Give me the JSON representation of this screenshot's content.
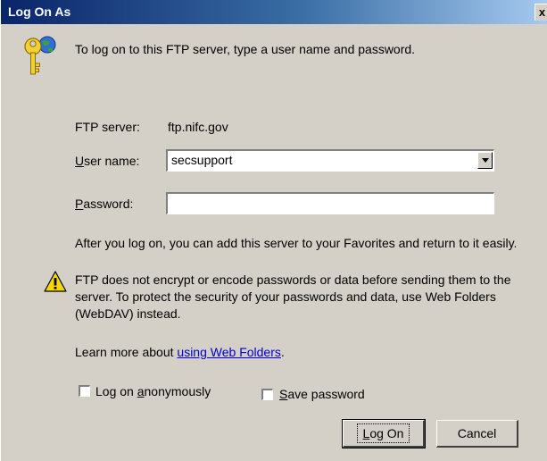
{
  "window": {
    "title": "Log On As",
    "close_glyph": "x"
  },
  "intro": {
    "icon": "key-globe-icon",
    "text": "To log on to this FTP server, type a user name and password."
  },
  "server": {
    "label": "FTP server:",
    "value": "ftp.nifc.gov"
  },
  "username": {
    "label_accel": "U",
    "label_rest": "ser name:",
    "value": "secsupport"
  },
  "password": {
    "label_accel": "P",
    "label_rest": "assword:",
    "value": ""
  },
  "favorites_note": "After you log on, you can add this server to your Favorites and return to it easily.",
  "warning": {
    "icon": "warning-icon",
    "line1": "FTP does not encrypt or encode passwords or data before sending them to the",
    "line2": "server.  To protect the security of your passwords and data, use Web Folders",
    "line3": "(WebDAV) instead."
  },
  "learn_more": {
    "prefix": "Learn more about ",
    "link": "using Web Folders",
    "suffix": "."
  },
  "options": {
    "anonymous_pre": "Log on ",
    "anonymous_accel": "a",
    "anonymous_post": "nonymously",
    "anonymous_checked": false,
    "save_accel": "S",
    "save_post": "ave password",
    "save_checked": false
  },
  "buttons": {
    "logon_accel": "L",
    "logon_rest": "og On",
    "cancel": "Cancel"
  }
}
